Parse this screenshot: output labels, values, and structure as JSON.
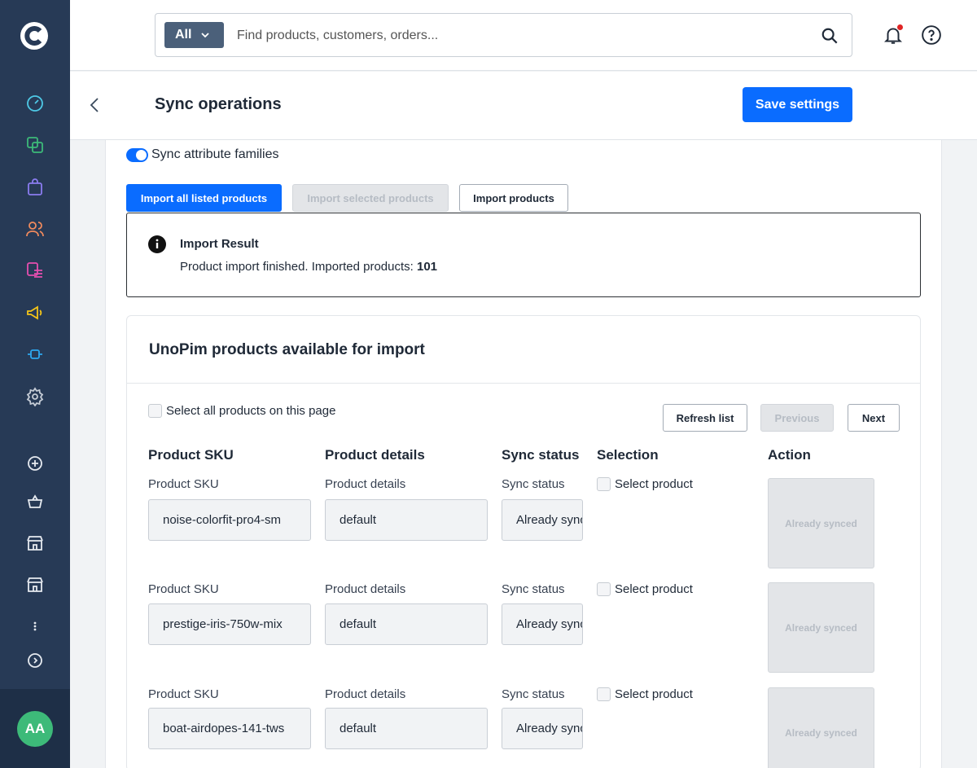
{
  "topbar": {
    "scope_label": "All",
    "search_placeholder": "Find products, customers, orders..."
  },
  "header": {
    "title": "Sync operations",
    "save_label": "Save settings"
  },
  "sync": {
    "toggle_label": "Sync attribute families",
    "toggle_on": true
  },
  "actions": {
    "import_all": "Import all listed products",
    "import_selected": "Import selected products",
    "import_products": "Import products"
  },
  "result": {
    "title": "Import Result",
    "message": "Product import finished. Imported products:",
    "count": "101"
  },
  "panel": {
    "title": "UnoPim products available for import",
    "select_all": "Select all products on this page",
    "refresh": "Refresh list",
    "previous": "Previous",
    "next": "Next",
    "columns": [
      "Product SKU",
      "Product details",
      "Sync status",
      "Selection",
      "Action"
    ],
    "rows": [
      {
        "sku_label": "Product SKU",
        "sku": "noise-colorfit-pro4-sm",
        "details_label": "Product details",
        "details": "default",
        "status_label": "Sync status",
        "status": "Already synced",
        "select_label": "Select product",
        "action": "Already synced"
      },
      {
        "sku_label": "Product SKU",
        "sku": "prestige-iris-750w-mix",
        "details_label": "Product details",
        "details": "default",
        "status_label": "Sync status",
        "status": "Already synced",
        "select_label": "Select product",
        "action": "Already synced"
      },
      {
        "sku_label": "Product SKU",
        "sku": "boat-airdopes-141-tws",
        "details_label": "Product details",
        "details": "default",
        "status_label": "Sync status",
        "status": "Already synced",
        "select_label": "Select product",
        "action": "Already synced"
      }
    ]
  },
  "user": {
    "initials": "AA"
  },
  "colors": {
    "sidebar": "#273a56",
    "accent": "#0a6cff",
    "avatar": "#3dba79"
  },
  "sidebar_icons": [
    "dashboard-icon",
    "copy-icon",
    "shopping-bag-icon",
    "customers-icon",
    "list-icon",
    "megaphone-icon",
    "plug-icon",
    "settings-icon",
    "plus-circle-icon",
    "basket-icon",
    "store-icon",
    "store-alt-icon",
    "more-icon",
    "chevron-right-circle-icon"
  ]
}
